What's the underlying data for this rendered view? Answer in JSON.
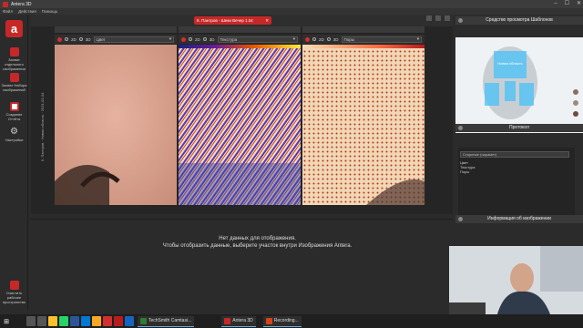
{
  "window": {
    "title": "Antera 3D",
    "controls": [
      "–",
      "☐",
      "✕"
    ]
  },
  "menu": [
    "Файл",
    "Действия",
    "Помощь"
  ],
  "document_tab": {
    "label": "К. Пантров - Шеки Вечер 1.txt",
    "close": "✕"
  },
  "sidebar": {
    "logo": "a",
    "items": [
      {
        "label": "Захват отдельного изображения",
        "icon": "camera-icon",
        "color": "#c62828"
      },
      {
        "label": "Захват Набора изображений",
        "icon": "camera-set-icon",
        "color": "#c62828"
      },
      {
        "label": "Создание Отчёта",
        "icon": "report-icon",
        "color": "#c62828"
      },
      {
        "label": "Настройки",
        "icon": "gear-icon",
        "color": "#cccccc"
      },
      {
        "label": "Очистить рабочее пространство",
        "icon": "clear-icon",
        "color": "#c62828"
      }
    ]
  },
  "viewer": {
    "panels": [
      {
        "mode_2d": "2D",
        "mode_3d": "3D",
        "select": "Цвет"
      },
      {
        "mode_2d": "2D",
        "mode_3d": "3D",
        "select": "Текстура"
      },
      {
        "mode_2d": "2D",
        "mode_3d": "3D",
        "select": "Поры"
      }
    ],
    "vertical_label": "К. Пантров · Новая область · 2021-02-04"
  },
  "lower": {
    "line1": "Нет данных для отображения.",
    "line2": "Чтобы отобразить данные, выберите участок внутри Изображения Antera."
  },
  "right": {
    "template_title": "Средство просмотра Шаблонов",
    "template_label": "Новая область",
    "protocol_title": "Протокол",
    "protocol_select": "Старение (парамет)",
    "protocol_items": [
      "Цвет",
      "Текстура",
      "Поры"
    ],
    "info_title": "Информация об изображении"
  },
  "taskbar": {
    "tasks": [
      {
        "label": "TechSmith Camtasi...",
        "color": "#2e7d32"
      },
      {
        "label": "Antera 3D",
        "color": "#c62828"
      },
      {
        "label": "Recording...",
        "color": "#d84315"
      }
    ],
    "pinned": [
      {
        "name": "search-icon",
        "color": "#555555"
      },
      {
        "name": "task-view-icon",
        "color": "#555555"
      },
      {
        "name": "chrome-icon",
        "color": "#fbc02d"
      },
      {
        "name": "whatsapp-icon",
        "color": "#25d366"
      },
      {
        "name": "word-icon",
        "color": "#2b579a"
      },
      {
        "name": "outlook-icon",
        "color": "#0078d4"
      },
      {
        "name": "explorer-icon",
        "color": "#f9a825"
      },
      {
        "name": "opera-icon",
        "color": "#d32f2f"
      },
      {
        "name": "pdf-icon",
        "color": "#b71c1c"
      },
      {
        "name": "photoshop-icon",
        "color": "#1565c0"
      }
    ]
  }
}
